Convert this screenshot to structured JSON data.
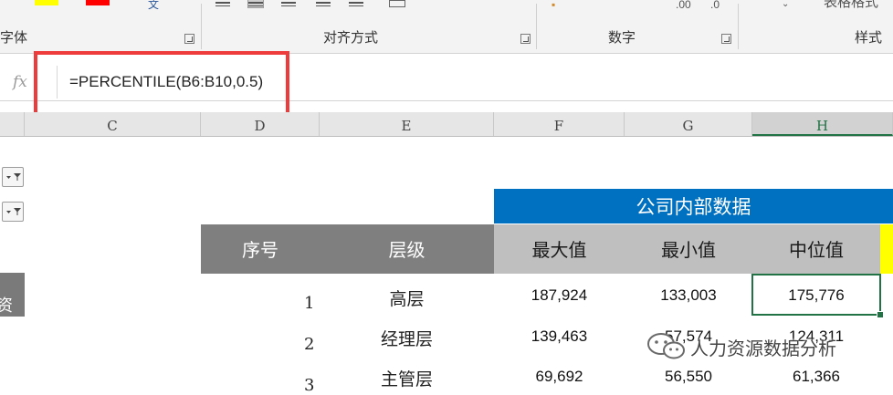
{
  "ribbon": {
    "groups": [
      {
        "label": "字体"
      },
      {
        "label": "对齐方式"
      },
      {
        "label": "数字"
      },
      {
        "label": "样式"
      }
    ],
    "table_format_label": "表格格式",
    "colors": {
      "fill_color": "#ffff00",
      "font_color": "#ff0000"
    }
  },
  "formula_bar": {
    "fx_label": "fx",
    "formula": "=PERCENTILE(B6:B10,0.5)"
  },
  "columns": [
    "C",
    "D",
    "E",
    "F",
    "G",
    "H"
  ],
  "selected_column": "H",
  "left_strip_char": "资",
  "table": {
    "band_title": "公司内部数据",
    "headers": [
      "序号",
      "层级",
      "最大值",
      "最小值",
      "中位值"
    ],
    "rows": [
      {
        "seq": "1",
        "level": "高层",
        "max": "187,924",
        "min": "133,003",
        "median": "175,776"
      },
      {
        "seq": "2",
        "level": "经理层",
        "max": "139,463",
        "min": "57,574",
        "median": "124,311"
      },
      {
        "seq": "3",
        "level": "主管层",
        "max": "69,692",
        "min": "56,550",
        "median": "61,366"
      }
    ]
  },
  "watermark": {
    "text": "人力资源数据分析",
    "icon": "wechat-icon"
  },
  "theme": {
    "accent_blue": "#0070c0",
    "header_gray": "#7f7f7f",
    "selection_green": "#217346",
    "highlight_red": "#ee3b3b"
  }
}
